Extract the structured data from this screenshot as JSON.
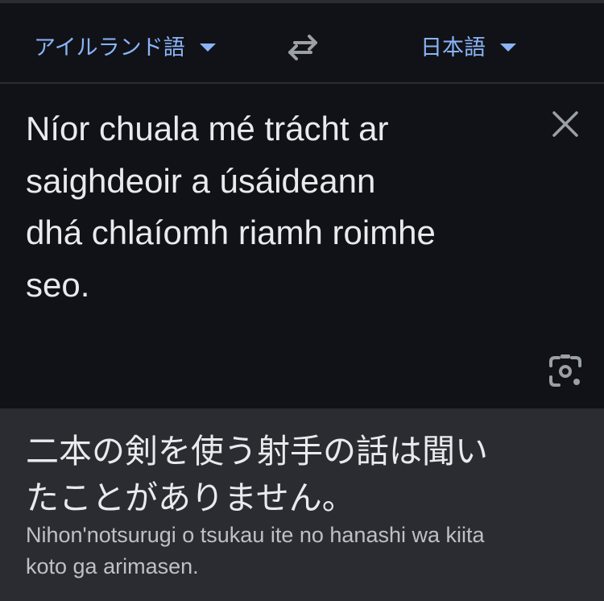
{
  "language_bar": {
    "source_language": "アイルランド語",
    "target_language": "日本語",
    "caret_icon": "caret-down-icon",
    "swap_icon": "swap-arrows-icon"
  },
  "input": {
    "source_text": "Níor chuala mé trácht ar\nsaighdeoir a úsáideann\ndhá chlaíomh riamh roimhe\nseo.",
    "clear_icon": "close-icon",
    "lens_icon": "camera-lens-icon"
  },
  "result": {
    "translated_text": "二本の剣を使う射手の話は聞い\nたことがありません。",
    "romanization": "Nihon'notsurugi o tsukau ite no hanashi wa kiita\nkoto ga arimasen."
  },
  "colors": {
    "background": "#111217",
    "result_background": "#2b2c31",
    "accent": "#8ab4f8",
    "text": "#e8eaed",
    "muted_text": "#bdc1c6",
    "icon": "#9aa0a6"
  }
}
